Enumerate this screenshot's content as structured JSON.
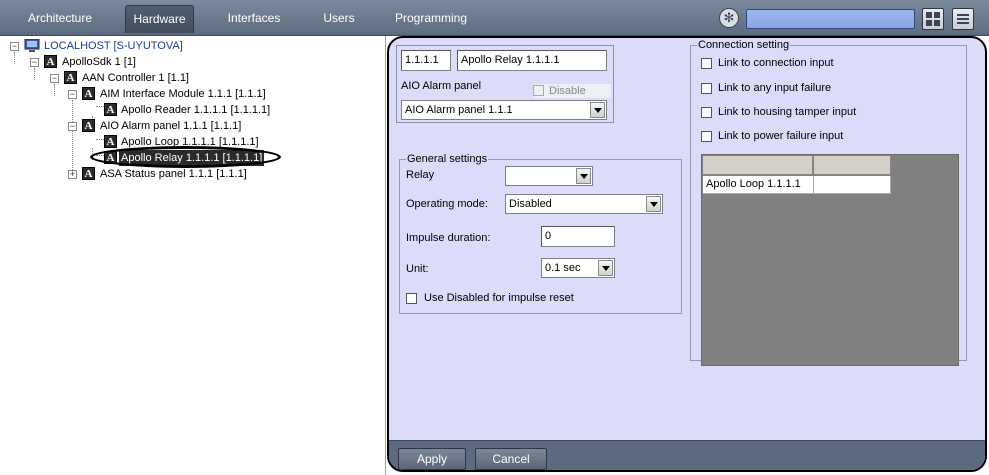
{
  "nav": {
    "tabs": [
      {
        "label": "Architecture"
      },
      {
        "label": "Hardware"
      },
      {
        "label": "Interfaces"
      },
      {
        "label": "Users"
      },
      {
        "label": "Programming"
      }
    ],
    "active_tab": "Hardware",
    "search_value": ""
  },
  "tree": {
    "nodes": [
      {
        "label": "LOCALHOST [S-UYUTOVA]"
      },
      {
        "label": "ApolloSdk 1 [1]"
      },
      {
        "label": "AAN Controller 1 [1.1]"
      },
      {
        "label": "AIM Interface Module 1.1.1 [1.1.1]"
      },
      {
        "label": "Apollo Reader 1.1.1.1 [1.1.1.1]"
      },
      {
        "label": "AIO Alarm panel 1.1.1 [1.1.1]"
      },
      {
        "label": "Apollo Loop 1.1.1.1 [1.1.1.1]"
      },
      {
        "label": "Apollo Relay 1.1.1.1 [1.1.1.1]"
      },
      {
        "label": "ASA Status panel 1.1.1 [1.1.1]"
      }
    ],
    "selected_index": 7
  },
  "object": {
    "id_value": "1.1.1.1",
    "name_value": "Apollo Relay 1.1.1.1",
    "parent_label": "AIO Alarm panel",
    "disable_label": "Disable",
    "disable_checked": false,
    "parent_select": "AIO Alarm panel 1.1.1"
  },
  "general": {
    "title": "General settings",
    "relay_label": "Relay",
    "relay_value": "",
    "mode_label": "Operating mode:",
    "mode_value": "Disabled",
    "impulse_label": "Impulse duration:",
    "impulse_value": "0",
    "unit_label": "Unit:",
    "unit_value": "0.1 sec",
    "use_disabled_label": "Use Disabled for impulse reset",
    "use_disabled_checked": false
  },
  "connection": {
    "title": "Connection setting",
    "options": [
      {
        "label": "Link to connection input",
        "checked": false
      },
      {
        "label": "Link to any input failure",
        "checked": false
      },
      {
        "label": "Link to housing tamper input",
        "checked": false
      },
      {
        "label": "Link to power failure input",
        "checked": false
      }
    ],
    "grid": {
      "headers": [
        "",
        ""
      ],
      "rows": [
        [
          "Apollo Loop 1.1.1.1",
          ""
        ]
      ]
    }
  },
  "buttons": {
    "apply": "Apply",
    "cancel": "Cancel"
  },
  "colors": {
    "topbar": "#6b788c",
    "panel_bg": "#dcdcfa",
    "search_bg": "#8eaae8",
    "selected_bg": "#2a2a2a"
  }
}
